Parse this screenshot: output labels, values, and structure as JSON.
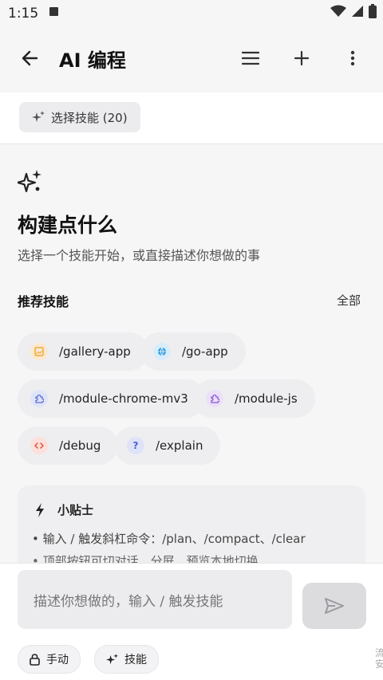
{
  "status_bar": {
    "time": "1:15"
  },
  "app_bar": {
    "title": "AI 编程",
    "icons": [
      "back-arrow-icon",
      "menu-icon",
      "plus-icon",
      "more-vert-icon"
    ]
  },
  "skill_selector": {
    "label": "选择技能 (20)"
  },
  "hero": {
    "title": "构建点什么",
    "subtitle": "选择一个技能开始，或直接描述你想做的事"
  },
  "recommended": {
    "title": "推荐技能",
    "all_label": "全部",
    "skills": [
      {
        "label": "/gallery-app",
        "icon": "gallery-icon",
        "color": "#f0a93b"
      },
      {
        "label": "/go-app",
        "icon": "globe-icon",
        "color": "#2f9be0"
      },
      {
        "label": "/module-chrome-mv3",
        "icon": "puzzle-icon",
        "color": "#5a6fd6"
      },
      {
        "label": "/module-js",
        "icon": "puzzle-icon",
        "color": "#8a55d8"
      },
      {
        "label": "/debug",
        "icon": "code-icon",
        "color": "#e0533c"
      },
      {
        "label": "/explain",
        "icon": "question-icon",
        "color": "#4a5fd0"
      }
    ]
  },
  "tips": {
    "title": "小贴士",
    "lines": [
      "• 输入 / 触发斜杠命令：/plan、/compact、/clear",
      "• 顶部按钮可切对话、分屏、预览本地切换"
    ]
  },
  "composer": {
    "placeholder": "描述你想做的，输入 / 触发技能",
    "mode_manual": "手动",
    "mode_skills": "技能"
  },
  "edge_text": "流\n安"
}
